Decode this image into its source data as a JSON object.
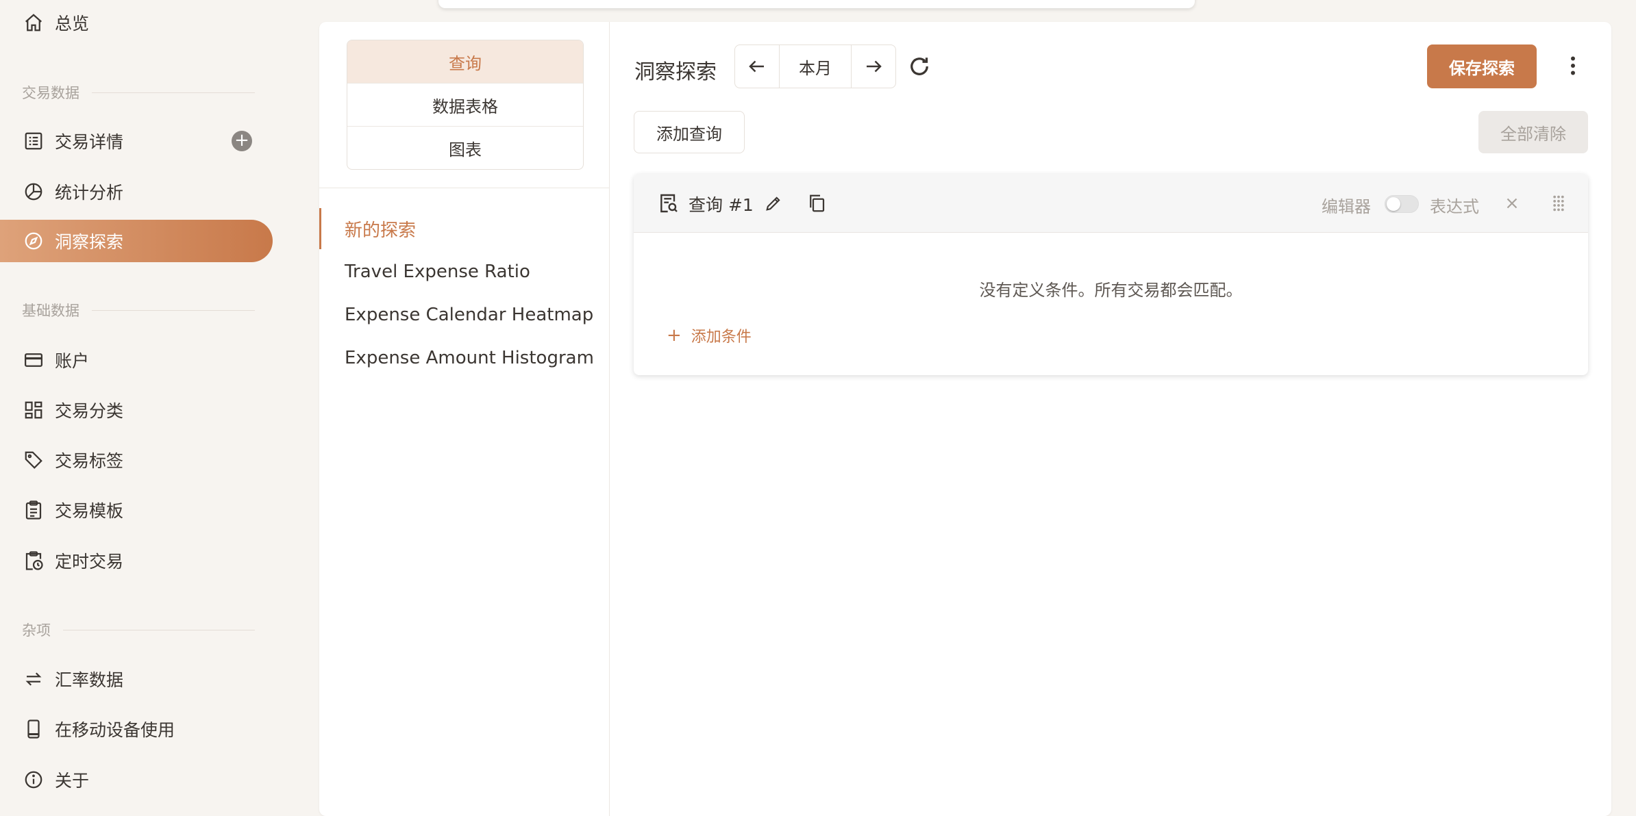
{
  "sidebar": {
    "overview": "总览",
    "section_transactions": "交易数据",
    "transaction_details": "交易详情",
    "statistics": "统计分析",
    "insights": "洞察探索",
    "section_basic": "基础数据",
    "accounts": "账户",
    "categories": "交易分类",
    "tags": "交易标签",
    "templates": "交易模板",
    "scheduled": "定时交易",
    "section_misc": "杂项",
    "exchange_rates": "汇率数据",
    "mobile": "在移动设备使用",
    "about": "关于"
  },
  "left_panel": {
    "tabs": [
      "查询",
      "数据表格",
      "图表"
    ],
    "explorations": [
      "新的探索",
      "Travel Expense Ratio",
      "Expense Calendar Heatmap",
      "Expense Amount Histogram"
    ]
  },
  "header": {
    "title": "洞察探索",
    "date_range": "本月",
    "save_label": "保存探索",
    "add_query_label": "添加查询",
    "clear_all_label": "全部清除"
  },
  "query": {
    "title": "查询 #1",
    "editor_label": "编辑器",
    "expression_label": "表达式",
    "expression_enabled": false,
    "empty_message": "没有定义条件。所有交易都会匹配。",
    "add_condition_label": "添加条件"
  },
  "colors": {
    "accent": "#c8794a",
    "accent_light": "#f6e8de",
    "background": "#f7f4f0"
  }
}
